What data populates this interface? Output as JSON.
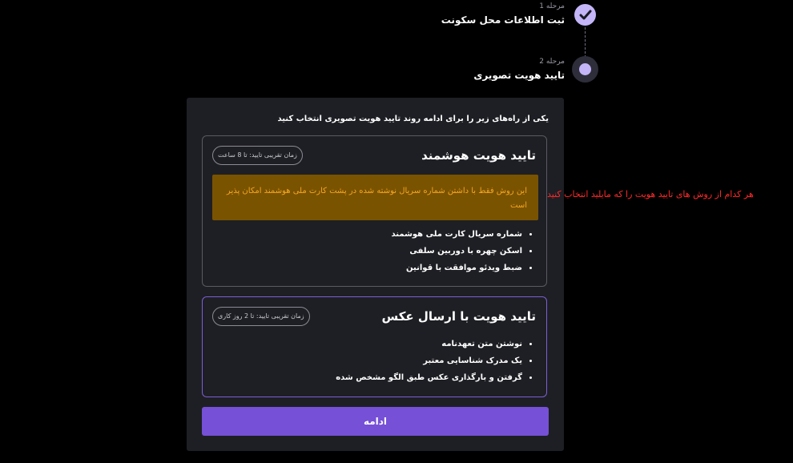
{
  "stepper": {
    "step1": {
      "label": "مرحله 1",
      "title": "ثبت اطلاعات محل سکونت",
      "status": "completed"
    },
    "step2": {
      "label": "مرحله 2",
      "title": "تایید هویت تصویری",
      "status": "active"
    }
  },
  "panel": {
    "intro": "یکی از راه‌های زیر را برای ادامه روند تایید هویت تصویری انتخاب کنید",
    "smart": {
      "title": "تایید هویت هوشمند",
      "badge": "زمان تقریبی تایید: تا 8 ساعت",
      "warning": "این روش فقط با داشتن شماره سریال نوشته شده در پشت کارت ملی هوشمند امکان پذیر است",
      "items": [
        "شماره سریال کارت ملی هوشمند",
        "اسکن چهره با دوربین سلفی",
        "ضبط ویدئو موافقت با قوانین"
      ]
    },
    "photo": {
      "title": "تایید هویت با ارسال عکس",
      "badge": "زمان تقریبی تایید: تا 2 روز کاری",
      "items": [
        "نوشتن متن تعهدنامه",
        "یک مدرک شناسایی معتبر",
        "گرفتن و بارگذاری عکس طبق الگو مشخص شده"
      ]
    },
    "continue_label": "ادامه"
  },
  "annotation": "هر کدام از روش های تایید هویت را که مایلید انتخاب کنید",
  "colors": {
    "accent": "#7650d6",
    "step": "#c3b5f7",
    "warning_bg": "#7a5300",
    "warning_text": "#f5a623",
    "annotation": "#ff2a2a"
  }
}
